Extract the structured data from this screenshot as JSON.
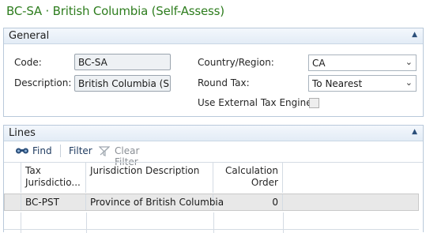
{
  "title": "BC-SA · British Columbia (Self-Assess)",
  "general": {
    "header": "General",
    "code_label": "Code:",
    "code_value": "BC-SA",
    "description_label": "Description:",
    "description_value": "British Columbia (S...",
    "country_label": "Country/Region:",
    "country_value": "CA",
    "round_tax_label": "Round Tax:",
    "round_tax_value": "To Nearest",
    "use_external_label": "Use External Tax Engine:",
    "use_external_checked": false
  },
  "lines": {
    "header": "Lines",
    "toolbar": {
      "find_label": "Find",
      "filter_label": "Filter",
      "clear_filter_label": "Clear Filter"
    },
    "columns": [
      "Tax Jurisdictio...",
      "Jurisdiction Description",
      "Calculation Order"
    ],
    "rows": [
      {
        "tax_jurisdiction": "BC-PST",
        "description": "Province of British Columbia",
        "calculation_order": "0"
      }
    ]
  },
  "icons": {
    "collapse": "chevron-up-icon",
    "find": "binoculars-icon",
    "clear_filter": "funnel-icon"
  }
}
